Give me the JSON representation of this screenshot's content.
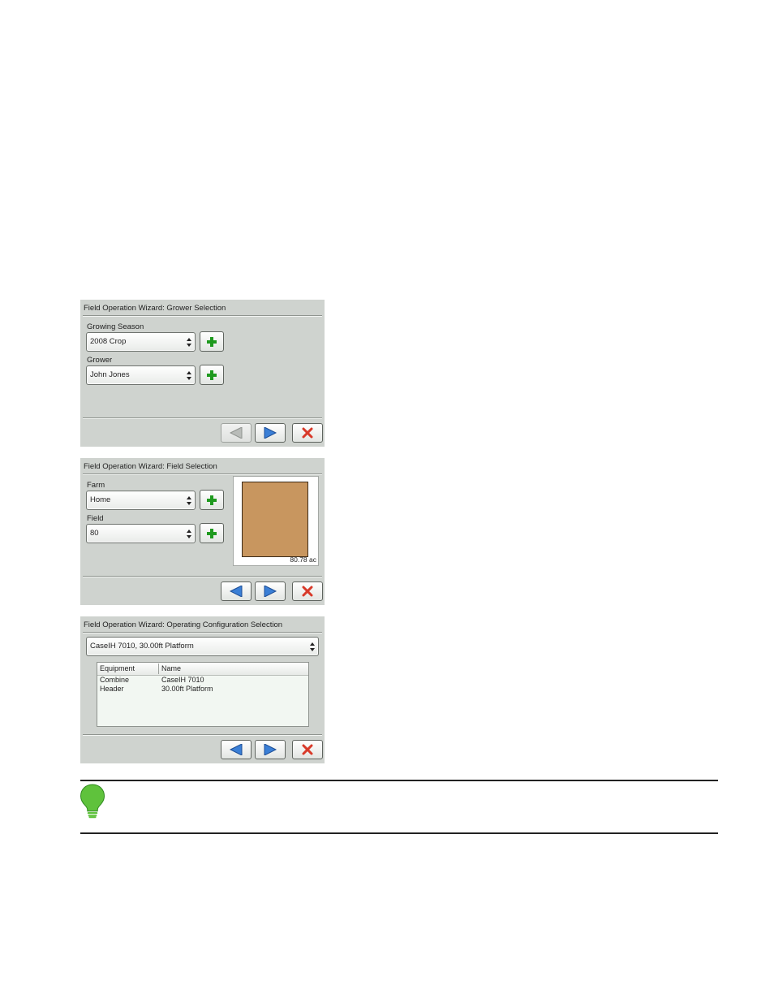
{
  "panels": {
    "grower": {
      "title": "Field Operation Wizard: Grower Selection",
      "season_label": "Growing Season",
      "season_value": "2008 Crop",
      "grower_label": "Grower",
      "grower_value": "John Jones"
    },
    "field": {
      "title": "Field Operation Wizard: Field Selection",
      "farm_label": "Farm",
      "farm_value": "Home",
      "field_label": "Field",
      "field_value": "80",
      "area": "80.78 ac"
    },
    "config": {
      "title": "Field Operation Wizard: Operating Configuration Selection",
      "config_value": "CaseIH 7010, 30.00ft Platform",
      "table": {
        "headers": [
          "Equipment",
          "Name"
        ],
        "rows": [
          [
            "Combine",
            "CaseIH 7010"
          ],
          [
            "Header",
            "30.00ft Platform"
          ]
        ]
      }
    }
  },
  "icons": {
    "add": "plus-icon",
    "back": "arrow-left-icon",
    "next": "arrow-right-icon",
    "cancel": "close-icon",
    "tip": "lightbulb-icon"
  },
  "colors": {
    "panel_bg": "#cfd3cf",
    "add_green": "#1f9a1f",
    "nav_blue": "#3a7fd6",
    "cancel_red": "#d83a2a",
    "tip_green": "#5fc23c",
    "field_shape": "#c8965f"
  }
}
